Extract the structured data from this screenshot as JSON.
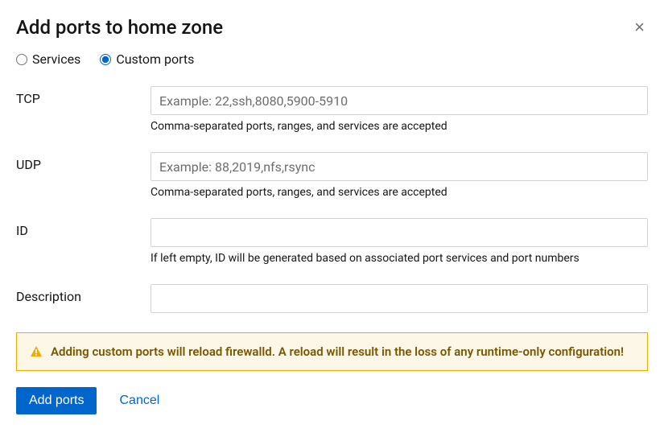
{
  "dialog": {
    "title": "Add ports to home zone"
  },
  "radio": {
    "services_label": "Services",
    "custom_ports_label": "Custom ports"
  },
  "fields": {
    "tcp": {
      "label": "TCP",
      "placeholder": "Example: 22,ssh,8080,5900-5910",
      "help": "Comma-separated ports, ranges, and services are accepted"
    },
    "udp": {
      "label": "UDP",
      "placeholder": "Example: 88,2019,nfs,rsync",
      "help": "Comma-separated ports, ranges, and services are accepted"
    },
    "id": {
      "label": "ID",
      "help": "If left empty, ID will be generated based on associated port services and port numbers"
    },
    "description": {
      "label": "Description"
    }
  },
  "alert": {
    "text": "Adding custom ports will reload firewalld. A reload will result in the loss of any runtime-only configuration!"
  },
  "buttons": {
    "submit": "Add ports",
    "cancel": "Cancel"
  }
}
